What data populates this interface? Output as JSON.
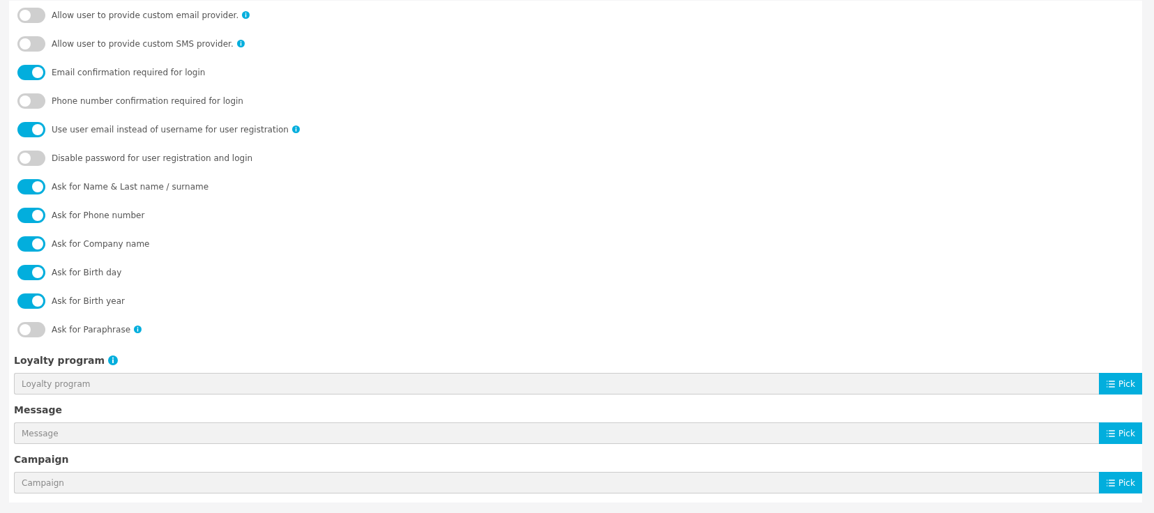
{
  "toggles": [
    {
      "label": "Allow user to provide custom email provider.",
      "on": false,
      "info": true
    },
    {
      "label": "Allow user to provide custom SMS provider.",
      "on": false,
      "info": true
    },
    {
      "label": "Email confirmation required for login",
      "on": true,
      "info": false
    },
    {
      "label": "Phone number confirmation required for login",
      "on": false,
      "info": false
    },
    {
      "label": "Use user email instead of username for user registration",
      "on": true,
      "info": true
    },
    {
      "label": "Disable password for user registration and login",
      "on": false,
      "info": false
    },
    {
      "label": "Ask for Name & Last name / surname",
      "on": true,
      "info": false
    },
    {
      "label": "Ask for Phone number",
      "on": true,
      "info": false
    },
    {
      "label": "Ask for Company name",
      "on": true,
      "info": false
    },
    {
      "label": "Ask for Birth day",
      "on": true,
      "info": false
    },
    {
      "label": "Ask for Birth year",
      "on": true,
      "info": false
    },
    {
      "label": "Ask for Paraphrase",
      "on": false,
      "info": true
    }
  ],
  "fields": [
    {
      "label": "Loyalty program",
      "info": true,
      "placeholder": "Loyalty program",
      "button": "Pick"
    },
    {
      "label": "Message",
      "info": false,
      "placeholder": "Message",
      "button": "Pick"
    },
    {
      "label": "Campaign",
      "info": false,
      "placeholder": "Campaign",
      "button": "Pick"
    }
  ]
}
